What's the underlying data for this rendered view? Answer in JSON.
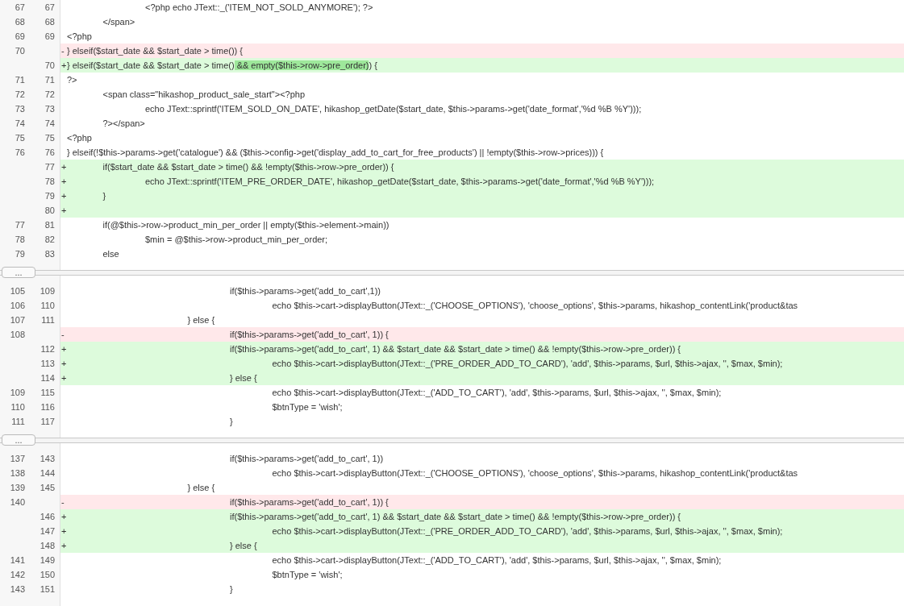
{
  "blocks": [
    {
      "kind": "hunk",
      "lines": [
        {
          "kind": "context",
          "old": "67",
          "new": "67",
          "text": "\t\t<?php echo JText::_('ITEM_NOT_SOLD_ANYMORE'); ?>"
        },
        {
          "kind": "context",
          "old": "68",
          "new": "68",
          "text": "\t</span>"
        },
        {
          "kind": "context",
          "old": "69",
          "new": "69",
          "text": "<?php"
        },
        {
          "kind": "removed",
          "old": "70",
          "prefix": "-",
          "text": "} elseif($start_date && $start_date > time()) {"
        },
        {
          "kind": "added",
          "new": "70",
          "prefix": "+",
          "parts": [
            {
              "text": "} elseif($start_date && $start_date > time()",
              "changed": false
            },
            {
              "text": " && empty($this->row->pre_order)",
              "changed": true
            },
            {
              "text": ") {",
              "changed": false
            }
          ]
        },
        {
          "kind": "context",
          "old": "71",
          "new": "71",
          "text": "?>"
        },
        {
          "kind": "context",
          "old": "72",
          "new": "72",
          "text": "\t<span class=\"hikashop_product_sale_start\"><?php"
        },
        {
          "kind": "context",
          "old": "73",
          "new": "73",
          "text": "\t\techo JText::sprintf('ITEM_SOLD_ON_DATE', hikashop_getDate($start_date, $this->params->get('date_format','%d %B %Y')));"
        },
        {
          "kind": "context",
          "old": "74",
          "new": "74",
          "text": "\t?></span>"
        },
        {
          "kind": "context",
          "old": "75",
          "new": "75",
          "text": "<?php"
        },
        {
          "kind": "context",
          "old": "76",
          "new": "76",
          "text": "} elseif(!$this->params->get('catalogue') && ($this->config->get('display_add_to_cart_for_free_products') || !empty($this->row->prices))) {"
        },
        {
          "kind": "added",
          "new": "77",
          "prefix": "+",
          "text": "\tif($start_date && $start_date > time() && !empty($this->row->pre_order)) {"
        },
        {
          "kind": "added",
          "new": "78",
          "prefix": "+",
          "text": "\t\techo JText::sprintf('ITEM_PRE_ORDER_DATE', hikashop_getDate($start_date, $this->params->get('date_format','%d %B %Y')));"
        },
        {
          "kind": "added",
          "new": "79",
          "prefix": "+",
          "text": "\t}"
        },
        {
          "kind": "added",
          "new": "80",
          "prefix": "+"
        },
        {
          "kind": "context",
          "old": "77",
          "new": "81",
          "text": "\tif(@$this->row->product_min_per_order || empty($this->element->main))"
        },
        {
          "kind": "context",
          "old": "78",
          "new": "82",
          "text": "\t\t$min = @$this->row->product_min_per_order;"
        },
        {
          "kind": "context",
          "old": "79",
          "new": "83",
          "text": "\telse"
        }
      ]
    },
    {
      "kind": "expander",
      "label": "..."
    },
    {
      "kind": "hunk",
      "lines": [
        {
          "kind": "context",
          "old": "105",
          "new": "109",
          "text": "\t\t\t\tif($this->params->get('add_to_cart',1))"
        },
        {
          "kind": "context",
          "old": "106",
          "new": "110",
          "text": "\t\t\t\t\techo $this->cart->displayButton(JText::_('CHOOSE_OPTIONS'), 'choose_options', $this->params, hikashop_contentLink('product&tas"
        },
        {
          "kind": "context",
          "old": "107",
          "new": "111",
          "text": "\t\t\t} else {"
        },
        {
          "kind": "removed",
          "old": "108",
          "prefix": "-",
          "text": "\t\t\t\tif($this->params->get('add_to_cart', 1)) {"
        },
        {
          "kind": "added",
          "new": "112",
          "prefix": "+",
          "text": "\t\t\t\tif($this->params->get('add_to_cart', 1) && $start_date && $start_date > time() && !empty($this->row->pre_order)) {"
        },
        {
          "kind": "added",
          "new": "113",
          "prefix": "+",
          "text": "\t\t\t\t\techo $this->cart->displayButton(JText::_('PRE_ORDER_ADD_TO_CARD'), 'add', $this->params, $url, $this->ajax, '', $max, $min);"
        },
        {
          "kind": "added",
          "new": "114",
          "prefix": "+",
          "text": "\t\t\t\t} else {"
        },
        {
          "kind": "context",
          "old": "109",
          "new": "115",
          "text": "\t\t\t\t\techo $this->cart->displayButton(JText::_('ADD_TO_CART'), 'add', $this->params, $url, $this->ajax, '', $max, $min);"
        },
        {
          "kind": "context",
          "old": "110",
          "new": "116",
          "text": "\t\t\t\t\t$btnType = 'wish';"
        },
        {
          "kind": "context",
          "old": "111",
          "new": "117",
          "text": "\t\t\t\t}"
        }
      ]
    },
    {
      "kind": "expander",
      "label": "..."
    },
    {
      "kind": "hunk",
      "lines": [
        {
          "kind": "context",
          "old": "137",
          "new": "143",
          "text": "\t\t\t\tif($this->params->get('add_to_cart', 1))"
        },
        {
          "kind": "context",
          "old": "138",
          "new": "144",
          "text": "\t\t\t\t\techo $this->cart->displayButton(JText::_('CHOOSE_OPTIONS'), 'choose_options', $this->params, hikashop_contentLink('product&tas"
        },
        {
          "kind": "context",
          "old": "139",
          "new": "145",
          "text": "\t\t\t} else {"
        },
        {
          "kind": "removed",
          "old": "140",
          "prefix": "-",
          "text": "\t\t\t\tif($this->params->get('add_to_cart', 1)) {"
        },
        {
          "kind": "added",
          "new": "146",
          "prefix": "+",
          "text": "\t\t\t\tif($this->params->get('add_to_cart', 1) && $start_date && $start_date > time() && !empty($this->row->pre_order)) {"
        },
        {
          "kind": "added",
          "new": "147",
          "prefix": "+",
          "text": "\t\t\t\t\techo $this->cart->displayButton(JText::_('PRE_ORDER_ADD_TO_CARD'), 'add', $this->params, $url, $this->ajax, '', $max, $min);"
        },
        {
          "kind": "added",
          "new": "148",
          "prefix": "+",
          "text": "\t\t\t\t} else {"
        },
        {
          "kind": "context",
          "old": "141",
          "new": "149",
          "text": "\t\t\t\t\techo $this->cart->displayButton(JText::_('ADD_TO_CART'), 'add', $this->params, $url, $this->ajax, '', $max, $min);"
        },
        {
          "kind": "context",
          "old": "142",
          "new": "150",
          "text": "\t\t\t\t\t$btnType = 'wish';"
        },
        {
          "kind": "context",
          "old": "143",
          "new": "151",
          "text": "\t\t\t\t}"
        }
      ]
    }
  ]
}
